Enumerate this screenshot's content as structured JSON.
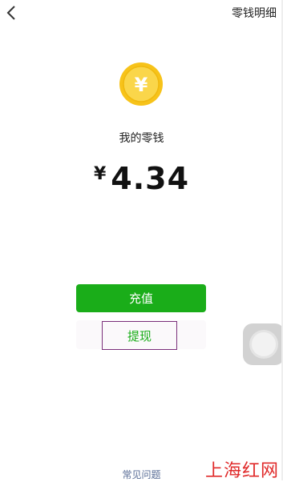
{
  "header": {
    "back_icon": "chevron-left-icon",
    "detail_label": "零钱明细"
  },
  "coin": {
    "icon": "yen-coin-icon",
    "symbol": "¥",
    "color": "#f5c518"
  },
  "balance": {
    "label": "我的零钱",
    "currency": "¥",
    "amount": "4.34"
  },
  "actions": {
    "recharge_label": "充值",
    "withdraw_label": "提现"
  },
  "footer": {
    "faq_label": "常见问题"
  },
  "watermark": {
    "text": "上海红网"
  },
  "colors": {
    "primary_green": "#1aad19",
    "link_blue": "#576b95",
    "withdraw_border": "#7a2f7a",
    "watermark_red": "#e02a2a"
  }
}
